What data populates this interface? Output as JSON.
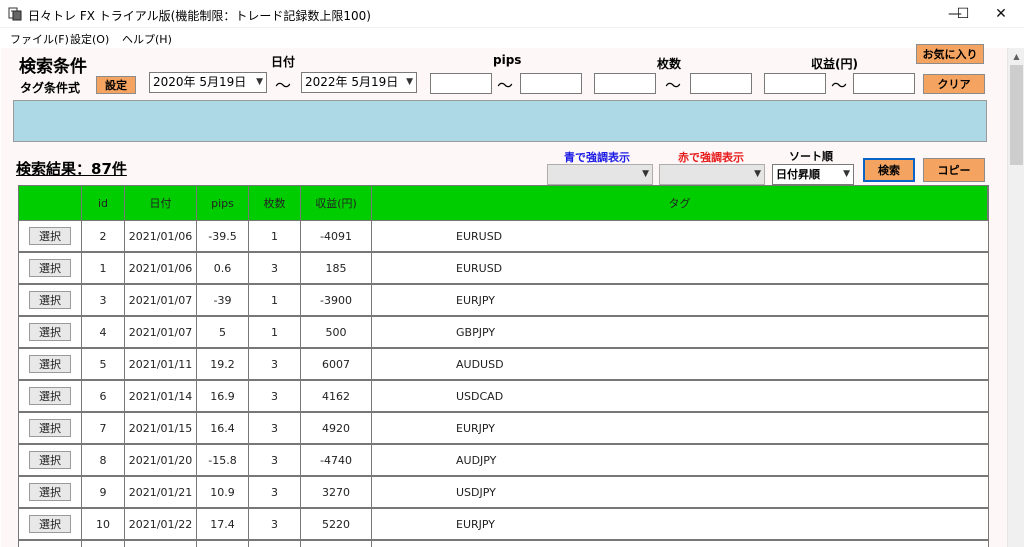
{
  "window": {
    "title": "日々トレ FX トライアル版(機能制限：トレード記録数上限100)",
    "minimize_glyph": "—",
    "maximize_glyph": "☐",
    "close_glyph": "✕"
  },
  "menu": [
    "ファイル(F)",
    "設定(O)",
    "ヘルプ(H)"
  ],
  "search": {
    "heading": "検索条件",
    "tag_condition_label": "タグ条件式",
    "settings_button": "設定",
    "date_label": "日付",
    "pips_label": "pips",
    "lots_label": "枚数",
    "profit_label": "収益(円)",
    "tilde": "〜",
    "date_from": "2020年  5月19日",
    "date_to": "2022年  5月19日",
    "pips_from": "",
    "pips_to": "",
    "lots_from": "",
    "lots_to": "",
    "profit_from": "",
    "profit_to": "",
    "favorites_button": "お気に入り",
    "clear_button": "クリア"
  },
  "results": {
    "heading": "検索結果：87件",
    "blue_highlight_label": "青で強調表示",
    "red_highlight_label": "赤で強調表示",
    "sort_label": "ソート順",
    "sort_value": "日付昇順",
    "search_button": "検索",
    "copy_button": "コピー",
    "select_label": "選択",
    "columns": [
      "",
      "id",
      "日付",
      "pips",
      "枚数",
      "収益(円)",
      "タグ"
    ],
    "rows": [
      {
        "id": "2",
        "date": "2021/01/06",
        "pips": "-39.5",
        "lots": "1",
        "profit": "-4091",
        "tag": "EURUSD"
      },
      {
        "id": "1",
        "date": "2021/01/06",
        "pips": "0.6",
        "lots": "3",
        "profit": "185",
        "tag": "EURUSD"
      },
      {
        "id": "3",
        "date": "2021/01/07",
        "pips": "-39",
        "lots": "1",
        "profit": "-3900",
        "tag": "EURJPY"
      },
      {
        "id": "4",
        "date": "2021/01/07",
        "pips": "5",
        "lots": "1",
        "profit": "500",
        "tag": "GBPJPY"
      },
      {
        "id": "5",
        "date": "2021/01/11",
        "pips": "19.2",
        "lots": "3",
        "profit": "6007",
        "tag": "AUDUSD"
      },
      {
        "id": "6",
        "date": "2021/01/14",
        "pips": "16.9",
        "lots": "3",
        "profit": "4162",
        "tag": "USDCAD"
      },
      {
        "id": "7",
        "date": "2021/01/15",
        "pips": "16.4",
        "lots": "3",
        "profit": "4920",
        "tag": "EURJPY"
      },
      {
        "id": "8",
        "date": "2021/01/20",
        "pips": "-15.8",
        "lots": "3",
        "profit": "-4740",
        "tag": "AUDJPY"
      },
      {
        "id": "9",
        "date": "2021/01/21",
        "pips": "10.9",
        "lots": "3",
        "profit": "3270",
        "tag": "USDJPY"
      },
      {
        "id": "10",
        "date": "2021/01/22",
        "pips": "17.4",
        "lots": "3",
        "profit": "5220",
        "tag": "EURJPY"
      }
    ]
  },
  "colors": {
    "header_green": "#00cd00",
    "button_orange": "#f4a460",
    "panel_blue": "#add8e6",
    "blue_text": "#1a1ae6",
    "red_text": "#e61a1a"
  }
}
